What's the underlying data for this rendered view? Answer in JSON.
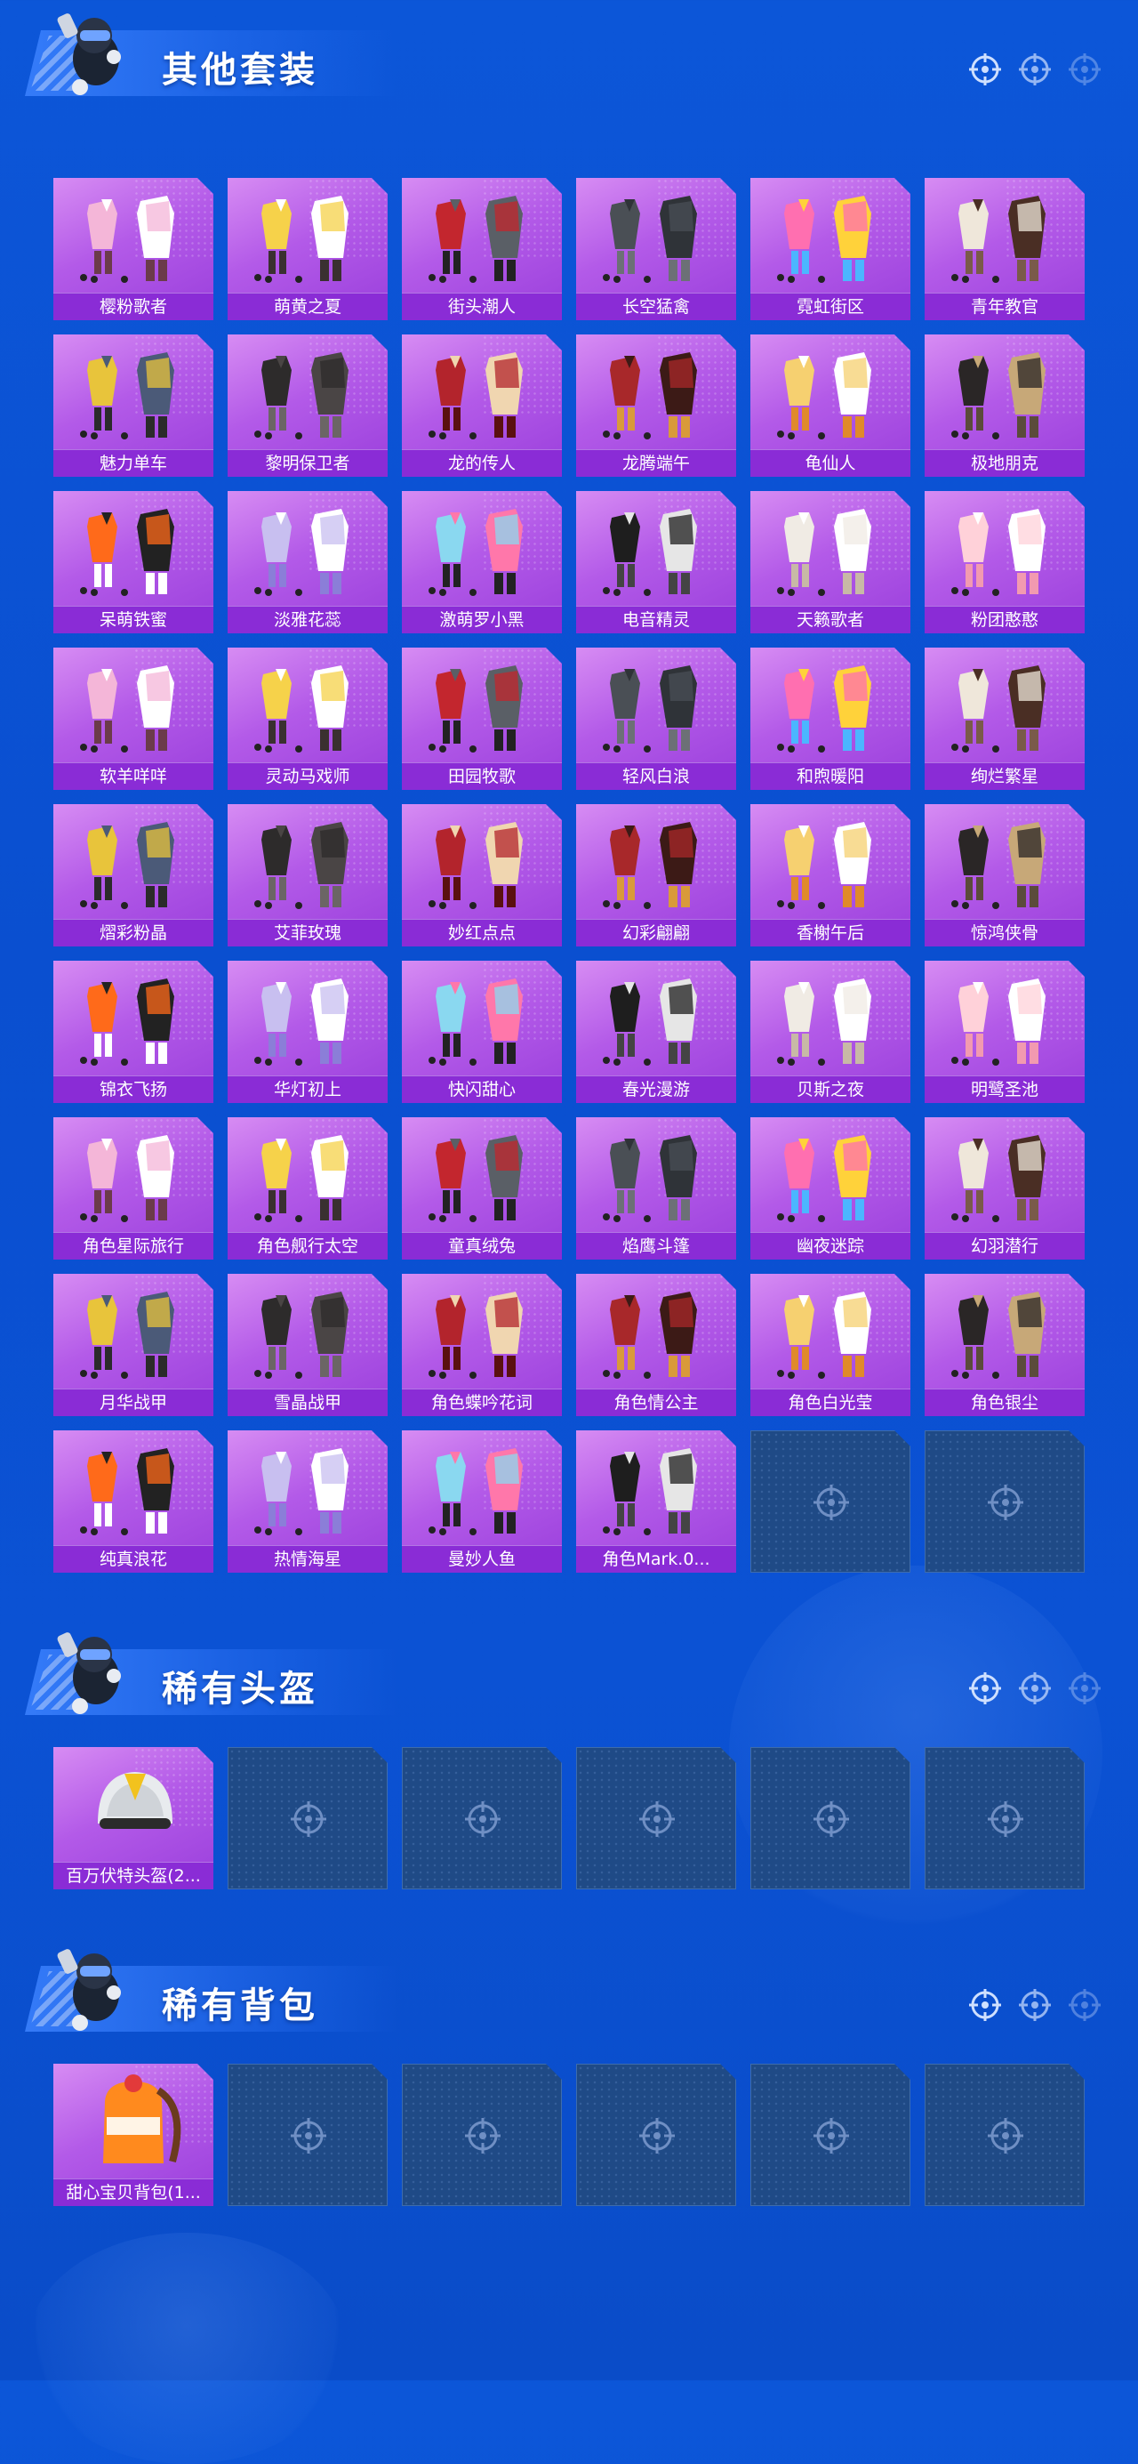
{
  "sections": {
    "outfits": {
      "title": "其他套装",
      "items": [
        "樱粉歌者",
        "萌黄之夏",
        "街头潮人",
        "长空猛禽",
        "霓虹街区",
        "青年教官",
        "魅力单车",
        "黎明保卫者",
        "龙的传人",
        "龙腾端午",
        "龟仙人",
        "极地朋克",
        "呆萌铁蜜",
        "淡雅花蕊",
        "激萌罗小黑",
        "电音精灵",
        "天籁歌者",
        "粉团憨憨",
        "软羊咩咩",
        "灵动马戏师",
        "田园牧歌",
        "轻风白浪",
        "和煦暖阳",
        "绚烂繁星",
        "熠彩粉晶",
        "艾菲玫瑰",
        "妙红点点",
        "幻彩翩翩",
        "香榭午后",
        "惊鸿侠骨",
        "锦衣飞扬",
        "华灯初上",
        "快闪甜心",
        "春光漫游",
        "贝斯之夜",
        "明鹭圣池",
        "角色星际旅行",
        "角色舰行太空",
        "童真绒兔",
        "焰鹰斗篷",
        "幽夜迷踪",
        "幻羽潜行",
        "月华战甲",
        "雪晶战甲",
        "角色蝶吟花词",
        "角色情公主",
        "角色白光莹",
        "角色银尘",
        "纯真浪花",
        "热情海星",
        "曼妙人鱼",
        "角色Mark.0..."
      ]
    },
    "helmets": {
      "title": "稀有头盔",
      "items": [
        "百万伏特头盔(2..."
      ]
    },
    "backpacks": {
      "title": "稀有背包",
      "items": [
        "甜心宝贝背包(1..."
      ]
    }
  },
  "colors": {
    "background": "#0b52d4",
    "card": "#b35ae8",
    "card_label": "#8a2cd6",
    "empty_slot": "#1f4a86"
  },
  "icons": {
    "section_mascot": "soldier-mascot-icon",
    "header_decor": "crosshair-icon",
    "empty_slot": "crosshair-icon"
  }
}
